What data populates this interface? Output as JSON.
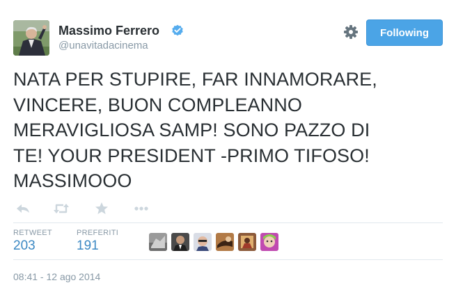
{
  "user": {
    "name": "Massimo Ferrero",
    "handle": "@unavitadacinema",
    "verified": true
  },
  "header": {
    "settings_icon": "gear-icon",
    "follow_button": "Following"
  },
  "tweet": {
    "lines": [
      "NATA PER STUPIRE, FAR INNAMORARE,",
      "VINCERE, BUON COMPLEANNO",
      "MERAVIGLIOSA SAMP! SONO PAZZO DI",
      "TE! YOUR PRESIDENT -PRIMO TIFOSO!",
      "MASSIMOOO"
    ]
  },
  "actions": [
    "reply-icon",
    "retweet-icon",
    "favorite-icon",
    "more-icon"
  ],
  "stats": {
    "retweets_label": "RETWEET",
    "retweets_value": "203",
    "favorites_label": "PREFERITI",
    "favorites_value": "191"
  },
  "timestamp": "08:41 - 12 ago 2014",
  "colors": {
    "accent": "#4ba4e6",
    "link": "#3b88c3",
    "muted": "#8899a6",
    "text": "#292f33",
    "verified": "#55acee"
  }
}
